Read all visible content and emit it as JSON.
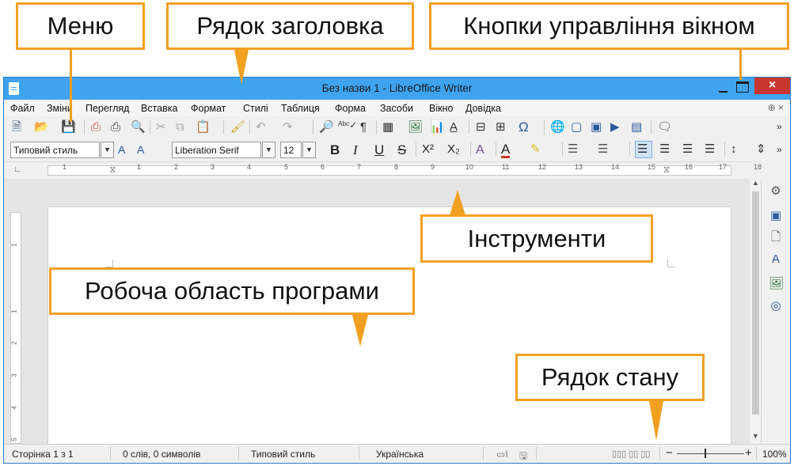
{
  "callouts": {
    "menu": "Меню",
    "titlebar": "Рядок заголовка",
    "window_buttons": "Кнопки управління вікном",
    "tools": "Інструменти",
    "workspace": "Робоча область програми",
    "statusbar": "Рядок стану"
  },
  "window": {
    "title": "Без назви 1 - LibreOffice Writer",
    "close_glyph": "×"
  },
  "menu": {
    "items": [
      "Файл",
      "Зміни",
      "Перегляд",
      "Вставка",
      "Формат",
      "Стилі",
      "Таблиця",
      "Форма",
      "Засоби",
      "Вікно",
      "Довідка"
    ],
    "close_doc": "×"
  },
  "toolbar": {
    "paragraph_style": "Типовий стиль",
    "font_name": "Liberation Serif",
    "font_size": "12",
    "bold": "B",
    "italic": "I",
    "underline": "U",
    "strike": "S",
    "superscript": "X²",
    "subscript": "X₂"
  },
  "ruler": {
    "numbers": [
      "1",
      "1",
      "2",
      "3",
      "4",
      "5",
      "6",
      "7",
      "8",
      "9",
      "10",
      "11",
      "12",
      "13",
      "14",
      "15",
      "16",
      "17",
      "18"
    ]
  },
  "left_ruler": {
    "numbers": [
      "1",
      "1",
      "2",
      "3",
      "4",
      "5"
    ]
  },
  "status": {
    "page": "Сторінка 1 з 1",
    "words": "0 слів, 0 символів",
    "style": "Типовий стиль",
    "language": "Українська",
    "zoom_minus": "−",
    "zoom_plus": "+",
    "zoom": "100%"
  },
  "colors": {
    "callout_border": "#f2a021",
    "titlebar": "#3fa3f0",
    "close_button": "#c8372f"
  }
}
